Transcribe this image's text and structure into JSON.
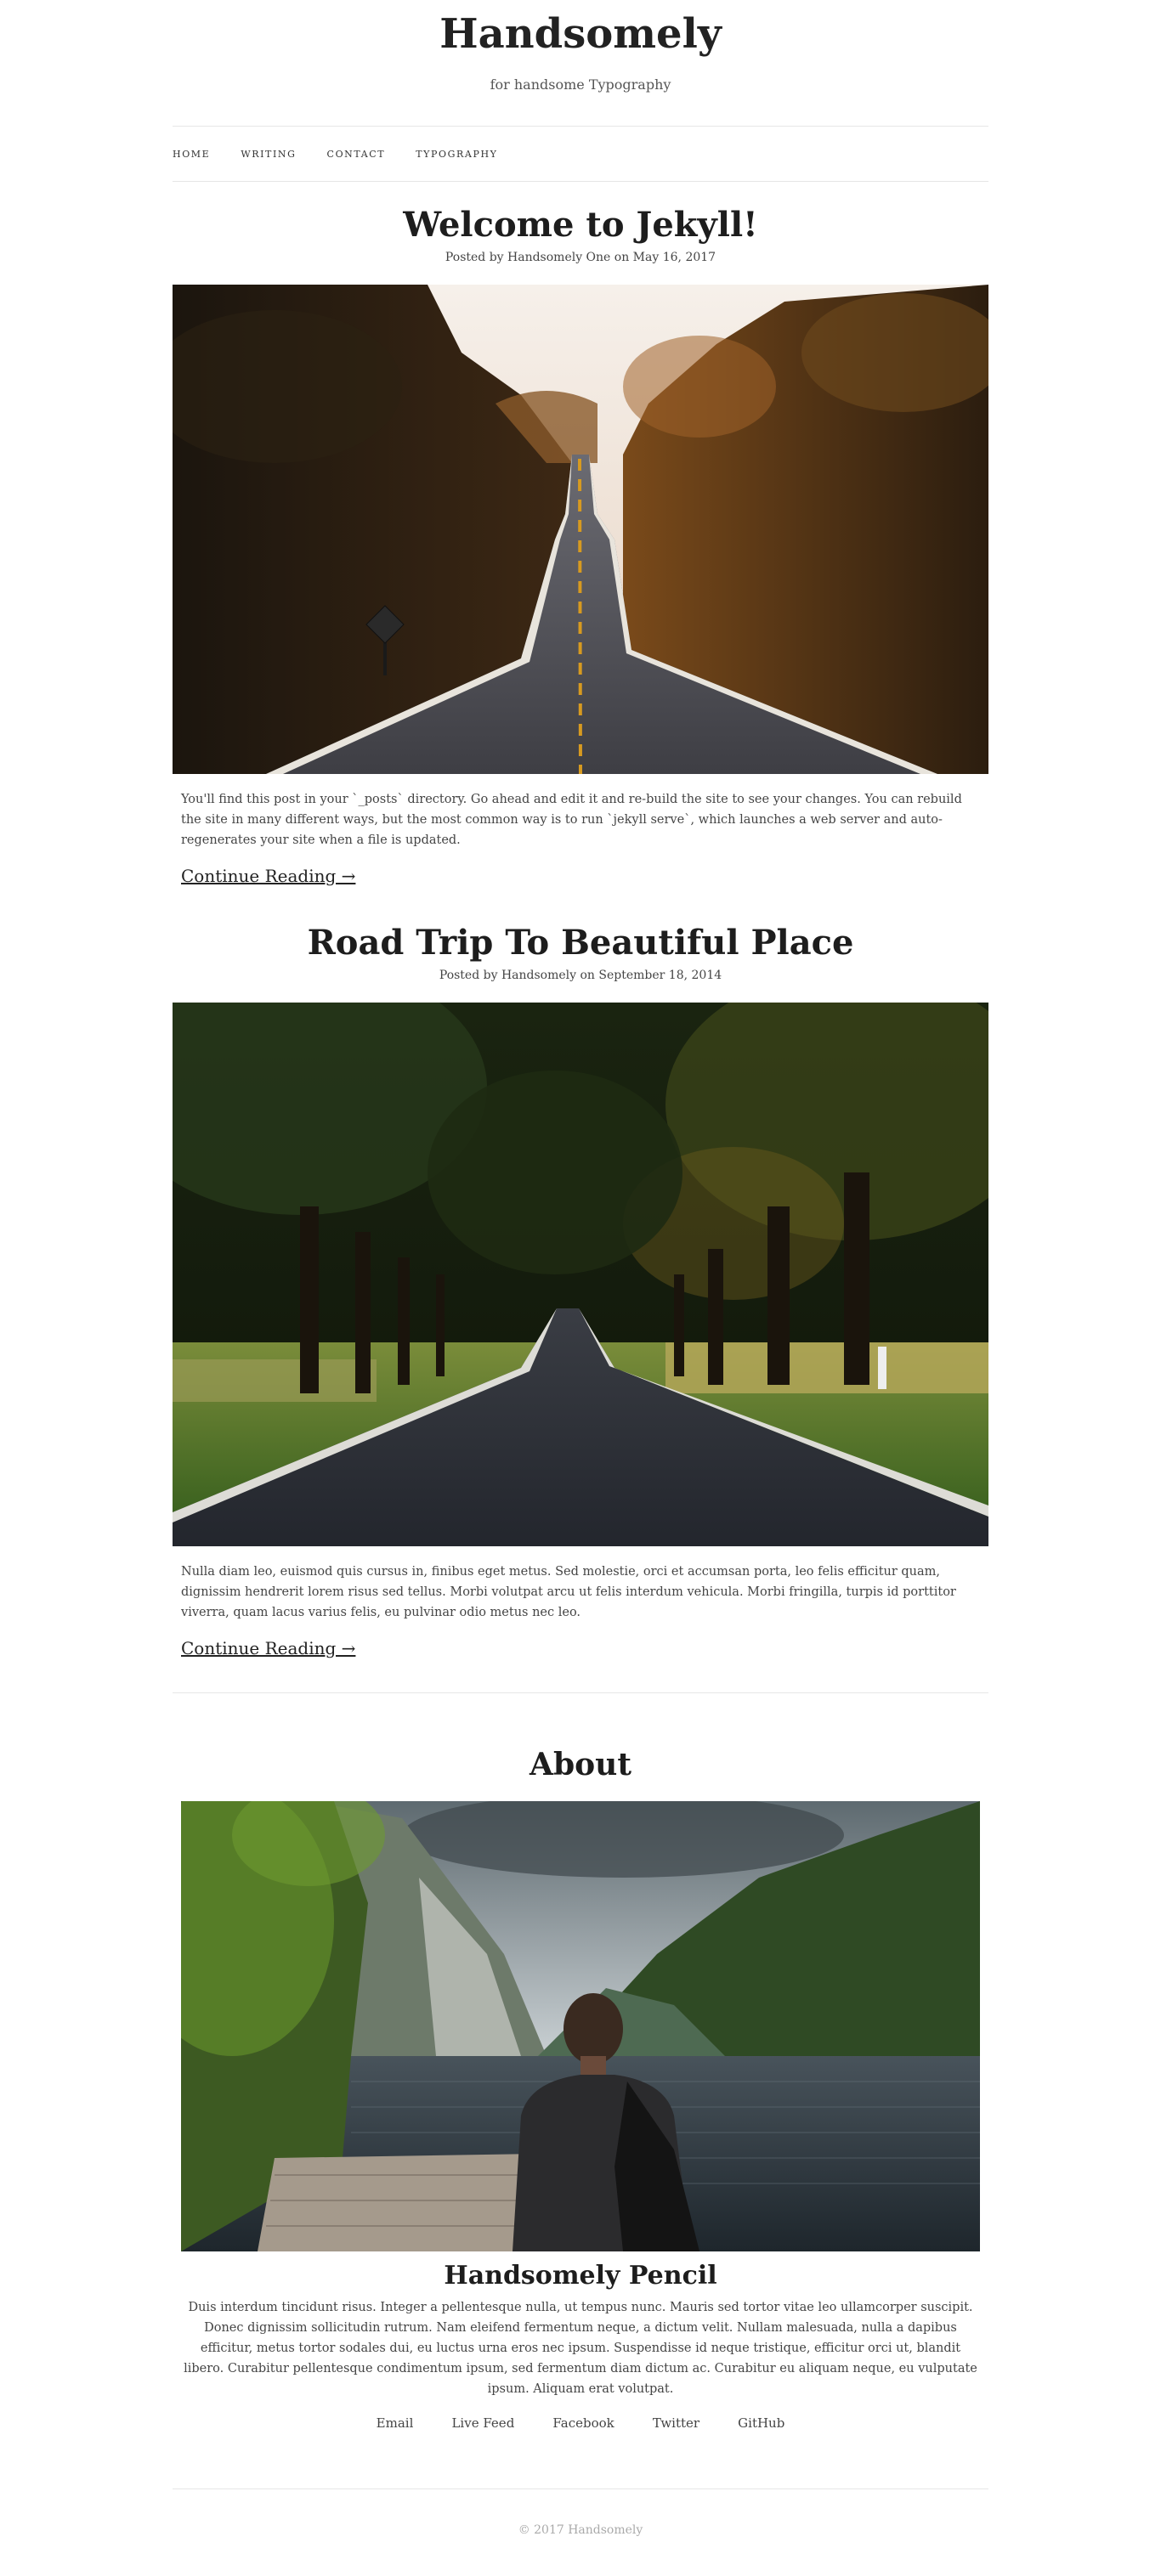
{
  "site": {
    "title": "Handsomely",
    "tagline": "for handsome Typography"
  },
  "nav": {
    "items": [
      "HOME",
      "WRITING",
      "CONTACT",
      "TYPOGRAPHY"
    ]
  },
  "posts": [
    {
      "title": "Welcome to Jekyll!",
      "meta": "Posted by Handsomely One on May 16, 2017",
      "excerpt": "You'll find this post in your `_posts` directory. Go ahead and edit it and re-build the site to see your changes. You can rebuild the site in many different ways, but the most common way is to run `jekyll serve`, which launches a web server and auto-regenerates your site when a file is updated.",
      "continue": "Continue Reading →"
    },
    {
      "title": "Road Trip To Beautiful Place",
      "meta": "Posted by Handsomely on September 18, 2014",
      "excerpt": "Nulla diam leo, euismod quis cursus in, finibus eget metus. Sed molestie, orci et accumsan porta, leo felis efficitur quam, dignissim hendrerit lorem risus sed tellus. Morbi volutpat arcu ut felis interdum vehicula. Morbi fringilla, turpis id porttitor viverra, quam lacus varius felis, eu pulvinar odio metus nec leo.",
      "continue": "Continue Reading →"
    }
  ],
  "about": {
    "heading": "About",
    "name": "Handsomely Pencil",
    "text": "Duis interdum tincidunt risus. Integer a pellentesque nulla, ut tempus nunc. Mauris sed tortor vitae leo ullamcorper suscipit. Donec dignissim sollicitudin rutrum. Nam eleifend fermentum neque, a dictum velit. Nullam malesuada, nulla a dapibus efficitur, metus tortor sodales dui, eu luctus urna eros nec ipsum. Suspendisse id neque tristique, efficitur orci ut, blandit libero. Curabitur pellentesque condimentum ipsum, sed fermentum diam dictum ac. Curabitur eu aliquam neque, eu vulputate ipsum. Aliquam erat volutpat.",
    "social": [
      "Email",
      "Live Feed",
      "Facebook",
      "Twitter",
      "GitHub"
    ]
  },
  "footer": {
    "copyright": "© 2017 Handsomely"
  }
}
